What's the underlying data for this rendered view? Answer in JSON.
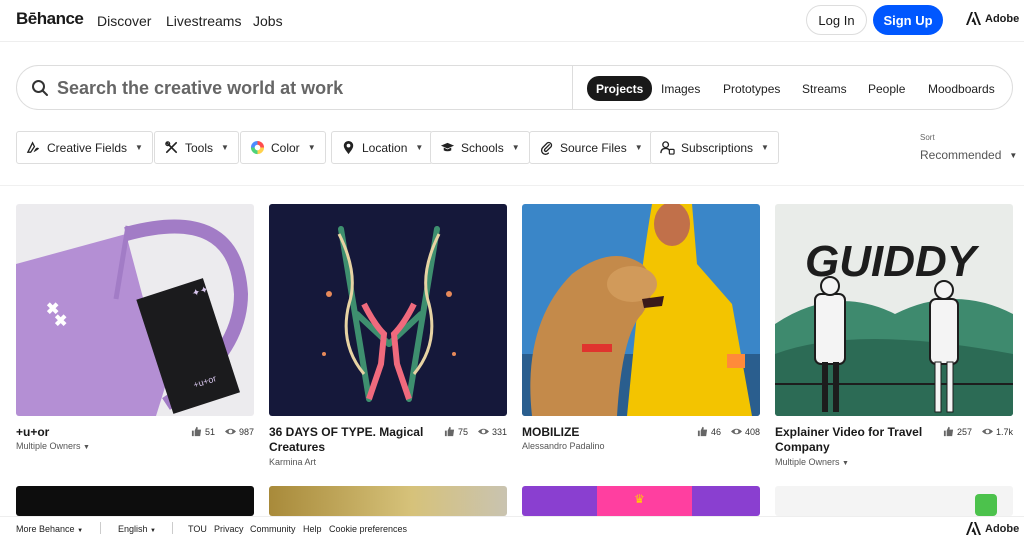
{
  "nav": {
    "logo": "Bēhance",
    "links": [
      "Discover",
      "Livestreams",
      "Jobs"
    ],
    "login": "Log In",
    "signup": "Sign Up",
    "adobe": "Adobe"
  },
  "search": {
    "placeholder": "Search the creative world at work",
    "tabs": [
      "Projects",
      "Images",
      "Prototypes",
      "Streams",
      "People",
      "Moodboards"
    ],
    "active_tab": "Projects"
  },
  "filters": [
    {
      "label": "Creative Fields",
      "icon": "creative-fields-icon"
    },
    {
      "label": "Tools",
      "icon": "tools-icon"
    },
    {
      "label": "Color",
      "icon": "color-wheel-icon"
    },
    {
      "label": "Location",
      "icon": "location-pin-icon"
    },
    {
      "label": "Schools",
      "icon": "graduation-cap-icon"
    },
    {
      "label": "Source Files",
      "icon": "paperclip-icon"
    },
    {
      "label": "Subscriptions",
      "icon": "subscriptions-icon"
    }
  ],
  "sort": {
    "label": "Sort",
    "value": "Recommended"
  },
  "projects": [
    {
      "title": "+u+or",
      "owner": "Multiple Owners",
      "owner_dropdown": true,
      "likes": "51",
      "views": "987"
    },
    {
      "title": "36 DAYS OF TYPE. Magical Creatures",
      "owner": "Karmina Art",
      "owner_dropdown": false,
      "likes": "75",
      "views": "331"
    },
    {
      "title": "MOBILIZE",
      "owner": "Alessandro Padalino",
      "owner_dropdown": false,
      "likes": "46",
      "views": "408"
    },
    {
      "title": "Explainer Video for Travel Company",
      "owner": "Multiple Owners",
      "owner_dropdown": true,
      "likes": "257",
      "views": "1.7k"
    }
  ],
  "artwork_text": {
    "guiddy": "GUIDDY",
    "tutor": "+u+or"
  },
  "footer": {
    "more": "More Behance",
    "language": "English",
    "links": [
      "TOU",
      "Privacy",
      "Community",
      "Help",
      "Cookie preferences"
    ],
    "adobe": "Adobe"
  },
  "colors": {
    "accent": "#0057ff",
    "dark": "#191919"
  }
}
